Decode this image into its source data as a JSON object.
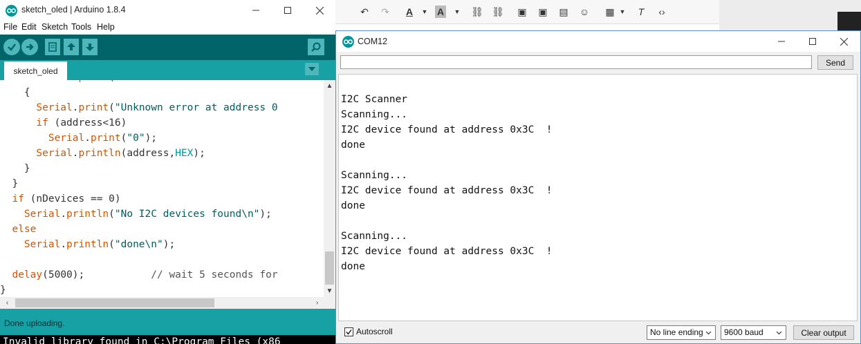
{
  "ide": {
    "title": "sketch_oled | Arduino 1.8.4",
    "menu": [
      "File",
      "Edit",
      "Sketch",
      "Tools",
      "Help"
    ],
    "tab_label": "sketch_oled",
    "code_lines": [
      {
        "indent": "    ",
        "segments": [
          {
            "t": "{",
            "c": ""
          }
        ]
      },
      {
        "indent": "      ",
        "segments": [
          {
            "t": "Serial",
            "c": "kw"
          },
          {
            "t": ".",
            "c": ""
          },
          {
            "t": "print",
            "c": "kw"
          },
          {
            "t": "(",
            "c": ""
          },
          {
            "t": "\"Unknown error at address 0",
            "c": "str"
          }
        ]
      },
      {
        "indent": "      ",
        "segments": [
          {
            "t": "if",
            "c": "kw"
          },
          {
            "t": " (address<16)",
            "c": ""
          }
        ]
      },
      {
        "indent": "        ",
        "segments": [
          {
            "t": "Serial",
            "c": "kw"
          },
          {
            "t": ".",
            "c": ""
          },
          {
            "t": "print",
            "c": "kw"
          },
          {
            "t": "(",
            "c": ""
          },
          {
            "t": "\"0\"",
            "c": "str"
          },
          {
            "t": ");",
            "c": ""
          }
        ]
      },
      {
        "indent": "      ",
        "segments": [
          {
            "t": "Serial",
            "c": "kw"
          },
          {
            "t": ".",
            "c": ""
          },
          {
            "t": "println",
            "c": "kw"
          },
          {
            "t": "(address,",
            "c": ""
          },
          {
            "t": "HEX",
            "c": "cst"
          },
          {
            "t": ");",
            "c": ""
          }
        ]
      },
      {
        "indent": "    ",
        "segments": [
          {
            "t": "}",
            "c": ""
          }
        ]
      },
      {
        "indent": "  ",
        "segments": [
          {
            "t": "}",
            "c": ""
          }
        ]
      },
      {
        "indent": "  ",
        "segments": [
          {
            "t": "if",
            "c": "kw"
          },
          {
            "t": " (nDevices == 0)",
            "c": ""
          }
        ]
      },
      {
        "indent": "    ",
        "segments": [
          {
            "t": "Serial",
            "c": "kw"
          },
          {
            "t": ".",
            "c": ""
          },
          {
            "t": "println",
            "c": "kw"
          },
          {
            "t": "(",
            "c": ""
          },
          {
            "t": "\"No I2C devices found\\n\"",
            "c": "str"
          },
          {
            "t": ");",
            "c": ""
          }
        ]
      },
      {
        "indent": "  ",
        "segments": [
          {
            "t": "else",
            "c": "kw"
          }
        ]
      },
      {
        "indent": "    ",
        "segments": [
          {
            "t": "Serial",
            "c": "kw"
          },
          {
            "t": ".",
            "c": ""
          },
          {
            "t": "println",
            "c": "kw"
          },
          {
            "t": "(",
            "c": ""
          },
          {
            "t": "\"done\\n\"",
            "c": "str"
          },
          {
            "t": ");",
            "c": ""
          }
        ]
      },
      {
        "indent": "",
        "segments": []
      },
      {
        "indent": "  ",
        "segments": [
          {
            "t": "delay",
            "c": "kw"
          },
          {
            "t": "(5000);",
            "c": ""
          },
          {
            "t": "           // wait 5 seconds for",
            "c": "cmt"
          }
        ]
      },
      {
        "indent": "",
        "segments": [
          {
            "t": "}",
            "c": ""
          }
        ]
      }
    ],
    "status": "Done uploading.",
    "console": "Invalid library found in C:\\Program Files (x86"
  },
  "monitor": {
    "title": "COM12",
    "send_label": "Send",
    "input_value": "",
    "output_lines": [
      "",
      "I2C Scanner",
      "Scanning...",
      "I2C device found at address 0x3C  !",
      "done",
      "",
      "Scanning...",
      "I2C device found at address 0x3C  !",
      "done",
      "",
      "Scanning...",
      "I2C device found at address 0x3C  !",
      "done"
    ],
    "autoscroll_label": "Autoscroll",
    "autoscroll_checked": true,
    "line_ending": "No line ending",
    "baud": "9600 baud",
    "clear_label": "Clear output"
  },
  "colors": {
    "arduino_teal": "#006468",
    "arduino_tab": "#17a1a5",
    "arduino_button": "#4db7bb",
    "keyword": "#d35400",
    "string": "#005c5f"
  }
}
